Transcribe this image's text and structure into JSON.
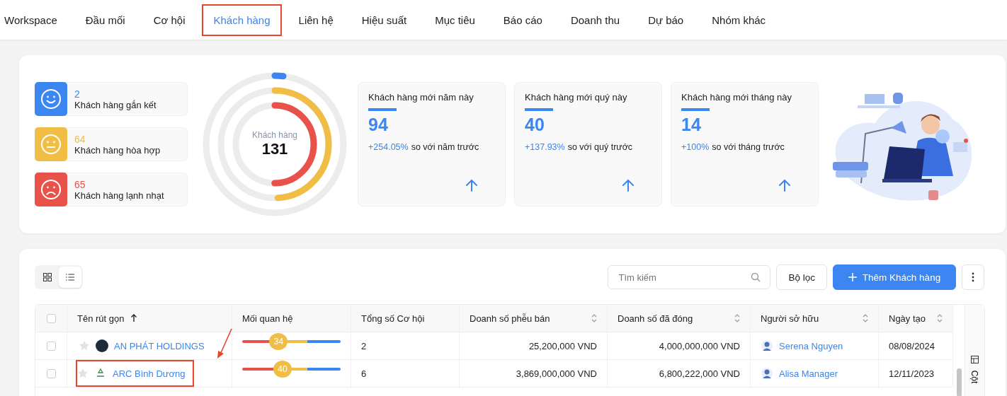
{
  "tabs": [
    {
      "label": "Workspace",
      "selected": false,
      "outlined": false
    },
    {
      "label": "Đầu mối",
      "selected": false,
      "outlined": false
    },
    {
      "label": "Cơ hội",
      "selected": false,
      "outlined": false
    },
    {
      "label": "Khách hàng",
      "selected": true,
      "outlined": true
    },
    {
      "label": "Liên hệ",
      "selected": false,
      "outlined": false
    },
    {
      "label": "Hiệu suất",
      "selected": false,
      "outlined": false
    },
    {
      "label": "Mục tiêu",
      "selected": false,
      "outlined": false
    },
    {
      "label": "Báo cáo",
      "selected": false,
      "outlined": false
    },
    {
      "label": "Doanh thu",
      "selected": false,
      "outlined": false
    },
    {
      "label": "Dự báo",
      "selected": false,
      "outlined": false
    },
    {
      "label": "Nhóm khác",
      "selected": false,
      "outlined": false
    }
  ],
  "segments": [
    {
      "kind": "happy",
      "count": "2",
      "label": "Khách hàng gắn kết",
      "color": "#3b86f0",
      "level": 0.02
    },
    {
      "kind": "neutral",
      "count": "64",
      "label": "Khách hàng hòa hợp",
      "color": "#f0bd45",
      "level": 0.49
    },
    {
      "kind": "sad",
      "count": "65",
      "label": "Khách hàng lạnh nhạt",
      "color": "#e8524a",
      "level": 0.5
    }
  ],
  "donut": {
    "label": "Khách hàng",
    "total": "131"
  },
  "stats": [
    {
      "title": "Khách hàng mới năm này",
      "value": "94",
      "change": "+254.05%",
      "comparison": "so với năm trước"
    },
    {
      "title": "Khách hàng mới quý này",
      "value": "40",
      "change": "+137.93%",
      "comparison": "so với quý trước"
    },
    {
      "title": "Khách hàng mới tháng này",
      "value": "14",
      "change": "+100%",
      "comparison": "so với tháng trước"
    }
  ],
  "view_toggle": [
    {
      "kind": "grid",
      "selected": false
    },
    {
      "kind": "list",
      "selected": true
    }
  ],
  "search": {
    "placeholder": "Tìm kiếm"
  },
  "filter_button": "Bộ lọc",
  "add_button": "Thêm Khách hàng",
  "table": {
    "all_checked": false,
    "columns": [
      {
        "label": "Tên rút gọn",
        "kind": "sorted"
      },
      {
        "label": "Mối quan hệ",
        "kind": "plain"
      },
      {
        "label": "Tổng số Cơ hội",
        "kind": "plain"
      },
      {
        "label": "Doanh số phễu bán",
        "kind": "sortable"
      },
      {
        "label": "Doanh số đã đóng",
        "kind": "sortable"
      },
      {
        "label": "Người sở hữu",
        "kind": "sortable"
      },
      {
        "label": "Ngày tạo",
        "kind": "sortable"
      }
    ],
    "rows": [
      {
        "checked": false,
        "starred": false,
        "kind": "round",
        "name": "AN PHÁT HOLDINGS",
        "outlined": false,
        "relation": "34",
        "level": 0.37,
        "opportunities": "2",
        "funnel": "25,200,000 VND",
        "closed": "4,000,000,000 VND",
        "owner": "Serena Nguyen",
        "created": "08/08/2024"
      },
      {
        "checked": false,
        "starred": false,
        "kind": "recycle",
        "name": "ARC Bình Dương",
        "outlined": true,
        "relation": "40",
        "level": 0.41,
        "opportunities": "6",
        "funnel": "3,869,000,000 VND",
        "closed": "6,800,222,000 VND",
        "owner": "Alisa Manager",
        "created": "12/11/2023"
      }
    ]
  },
  "columns_panel": "Cột"
}
